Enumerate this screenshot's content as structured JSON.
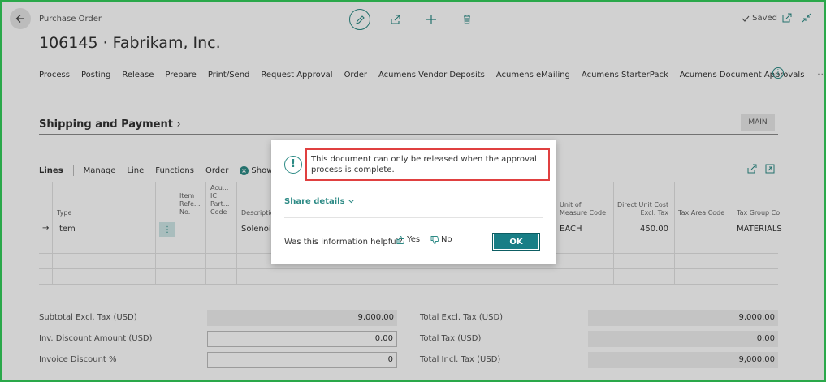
{
  "page": {
    "caption": "Purchase Order",
    "title": "106145 · Fabrikam, Inc.",
    "saved_label": "Saved"
  },
  "icons": {
    "back": "back-arrow-icon",
    "edit": "pencil-icon",
    "share": "share-icon",
    "new": "plus-icon",
    "delete": "trash-icon",
    "open_new_window": "open-in-new-window-icon",
    "collapse": "collapse-icon",
    "info": "info-icon"
  },
  "action_bar": {
    "items": [
      "Process",
      "Posting",
      "Release",
      "Prepare",
      "Print/Send",
      "Request Approval",
      "Order",
      "Acumens Vendor Deposits",
      "Acumens eMailing",
      "Acumens StarterPack",
      "Acumens Document Approvals"
    ],
    "more": "···"
  },
  "section": {
    "title": "Shipping and Payment",
    "chevron": "›",
    "tag": "MAIN"
  },
  "lines": {
    "label": "Lines",
    "actions": [
      "Manage",
      "Line",
      "Functions",
      "Order"
    ],
    "show_lines": "Show Lin",
    "columns": {
      "type": "Type",
      "item_ref": "Item\nRefe...\nNo.",
      "ic_partner": "Acu...\nIC\nPart...\nCode",
      "description": "Description",
      "uom": "Unit of\nMeasure Code",
      "direct_cost": "Direct Unit Cost\nExcl. Tax",
      "tax_area": "Tax Area Code",
      "tax_group": "Tax Group Co"
    },
    "row": {
      "type": "Item",
      "description": "Solenoid",
      "uom": "EACH",
      "direct_cost": "450.00",
      "tax_group": "MATERIALS"
    }
  },
  "totals": {
    "left": [
      {
        "label": "Subtotal Excl. Tax (USD)",
        "value": "9,000.00",
        "editable": false
      },
      {
        "label": "Inv. Discount Amount (USD)",
        "value": "0.00",
        "editable": true
      },
      {
        "label": "Invoice Discount %",
        "value": "0",
        "editable": true
      }
    ],
    "right": [
      {
        "label": "Total Excl. Tax (USD)",
        "value": "9,000.00"
      },
      {
        "label": "Total Tax (USD)",
        "value": "0.00"
      },
      {
        "label": "Total Incl. Tax (USD)",
        "value": "9,000.00"
      }
    ]
  },
  "dialog": {
    "icon": "!",
    "message": "This document can only be released when the approval process is complete.",
    "share_details": "Share details",
    "helpful_question": "Was this information helpful?",
    "yes": "Yes",
    "no": "No",
    "ok": "OK"
  },
  "colors": {
    "accent": "#2c8a85",
    "ok_button": "#187e86",
    "highlight_border": "#e04040",
    "frame_border": "#2aa84a"
  }
}
